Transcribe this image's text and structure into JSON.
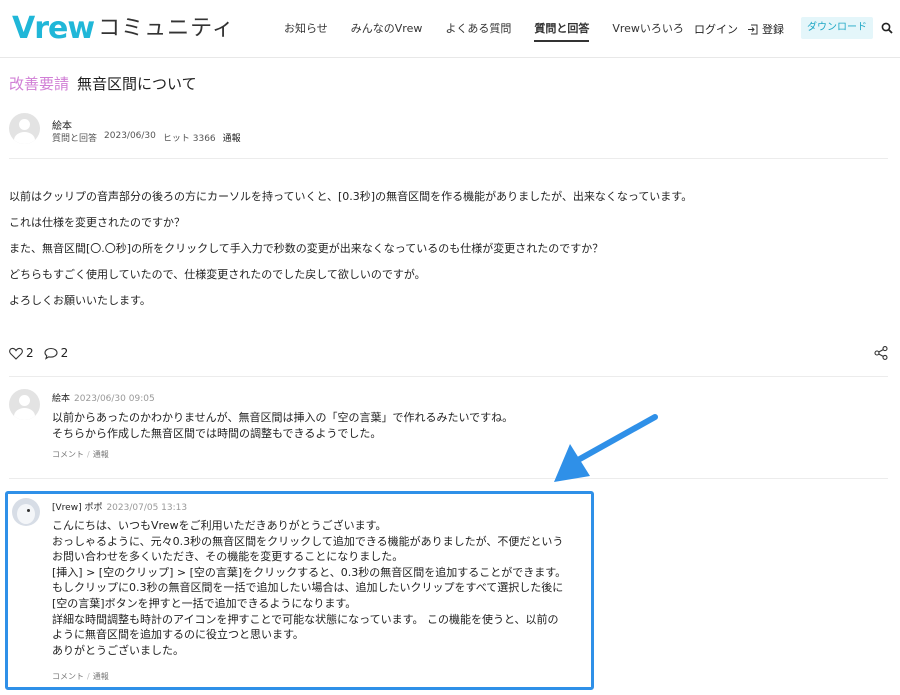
{
  "header": {
    "logo_brand": "Vrew",
    "logo_sub": "コミュニティ",
    "nav": [
      "お知らせ",
      "みんなのVrew",
      "よくある質問",
      "質問と回答",
      "Vrewいろいろ"
    ],
    "login": "ログイン",
    "register": "登録",
    "download": "ダウンロード"
  },
  "post": {
    "category": "改善要請",
    "title": "無音区間について",
    "author": "絵本",
    "meta": {
      "board": "質問と回答",
      "date": "2023/06/30",
      "hits": "ヒット 3366",
      "report": "通報"
    },
    "body": [
      "以前はクッリプの音声部分の後ろの方にカーソルを持っていくと、[0.3秒]の無音区間を作る機能がありましたが、出来なくなっています。",
      "これは仕様を変更されたのですか？",
      "また、無音区間[〇.〇秒]の所をクリックして手入力で秒数の変更が出来なくなっているのも仕様が変更されたのですか？",
      "どちらもすごく使用していたので、仕様変更されたのでした戻して欲しいのですが。",
      "よろしくお願いいたします。"
    ],
    "likes": "2",
    "comments": "2"
  },
  "comments": [
    {
      "author": "絵本",
      "date": "2023/06/30 09:05",
      "lines": [
        "以前からあったのかわかりませんが、無音区間は挿入の「空の言葉」で作れるみたいですね。",
        "そちらから作成した無音区間では時間の調整もできるようでした。"
      ],
      "comment_link": "コメント",
      "report_link": "通報"
    },
    {
      "author": "[Vrew] ポポ",
      "date": "2023/07/05 13:13",
      "lines": [
        "こんにちは、いつもVrewをご利用いただきありがとうございます。",
        "おっしゃるように、元々0.3秒の無音区間をクリックして追加できる機能がありましたが、不便だという",
        "お問い合わせを多くいただき、その機能を変更することになりました。",
        "[挿入] > [空のクリップ] > [空の言葉]をクリックすると、0.3秒の無音区間を追加することができます。",
        "もしクリップに0.3秒の無音区間を一括で追加したい場合は、追加したいクリップをすべて選択した後に",
        "[空の言葉]ボタンを押すと一括で追加できるようになります。",
        "詳細な時間調整も時計のアイコンを押すことで可能な状態になっています。 この機能を使うと、以前の",
        "ように無音区間を追加するのに役立つと思います。",
        "ありがとうございました。"
      ],
      "comment_link": "コメント",
      "report_link": "通報"
    }
  ],
  "colors": {
    "brand": "#20b7d8",
    "category": "#d17fd6",
    "highlight": "#2f90e8"
  }
}
